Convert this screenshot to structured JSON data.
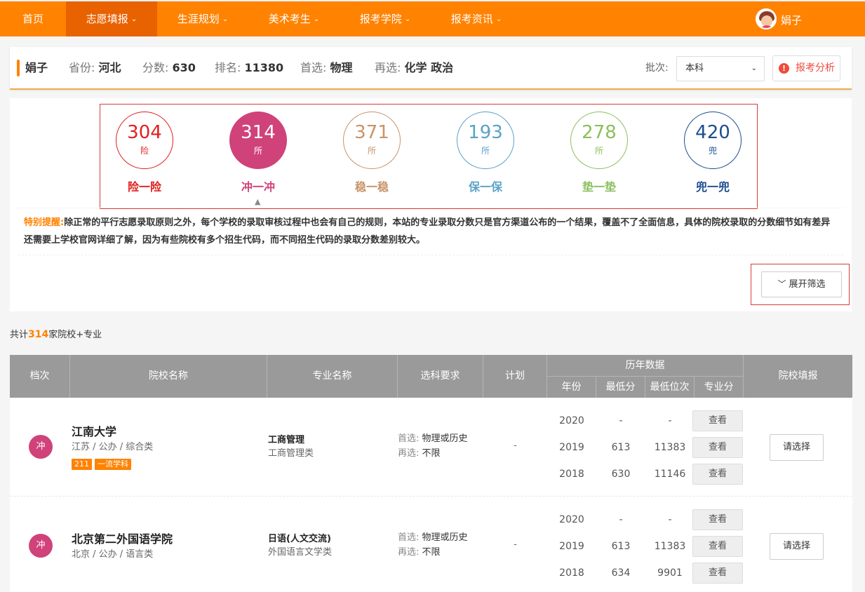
{
  "nav": {
    "items": [
      {
        "label": "首页",
        "has_menu": false
      },
      {
        "label": "志愿填报",
        "has_menu": true,
        "active": true
      },
      {
        "label": "生涯规划",
        "has_menu": true
      },
      {
        "label": "美术考生",
        "has_menu": true
      },
      {
        "label": "报考学院",
        "has_menu": true
      },
      {
        "label": "报考资讯",
        "has_menu": true
      }
    ],
    "user_name": "娟子"
  },
  "info": {
    "name": "娟子",
    "province_label": "省份:",
    "province": "河北",
    "score_label": "分数:",
    "score": "630",
    "rank_label": "排名:",
    "rank": "11380",
    "first_label": "首选:",
    "first": "物理",
    "second_label": "再选:",
    "second": "化学 政治",
    "batch_label": "批次:",
    "batch_value": "本科",
    "analysis_label": "报考分析"
  },
  "stats": [
    {
      "num": "304",
      "unit": "险",
      "label": "险一险",
      "color": "#e02020"
    },
    {
      "num": "314",
      "unit": "所",
      "label": "冲一冲",
      "color": "#d0427a",
      "active": true
    },
    {
      "num": "371",
      "unit": "所",
      "label": "稳一稳",
      "color": "#c8946a"
    },
    {
      "num": "193",
      "unit": "所",
      "label": "保一保",
      "color": "#5aa2c8"
    },
    {
      "num": "278",
      "unit": "所",
      "label": "垫一垫",
      "color": "#8bbf5e"
    },
    {
      "num": "420",
      "unit": "兜",
      "label": "兜一兜",
      "color": "#1d4e8f"
    }
  ],
  "notice": {
    "tag": "特别提醒:",
    "text": "除正常的平行志愿录取原则之外，每个学校的录取审核过程中也会有自己的规则，本站的专业录取分数只是官方渠道公布的一个结果，覆盖不了全面信息，具体的院校录取的分数细节如有差异还需要上学校官网详细了解，因为有些院校有多个招生代码，而不同招生代码的录取分数差别较大。"
  },
  "expand_label": "展开筛选",
  "count": {
    "prefix": "共计",
    "num": "314",
    "suffix": "家院校+专业"
  },
  "table": {
    "headers": {
      "level": "档次",
      "school": "院校名称",
      "major": "专业名称",
      "req": "选科要求",
      "plan": "计划",
      "history": "历年数据",
      "year": "年份",
      "min_score": "最低分",
      "min_rank": "最低位次",
      "major_score": "专业分",
      "fill": "院校填报"
    },
    "rows": [
      {
        "badge": "冲",
        "school": "江南大学",
        "meta": "江苏 / 公办 / 综合类",
        "tags": [
          "211",
          "一流学科"
        ],
        "major": "工商管理",
        "major_cat": "工商管理类",
        "req_first_label": "首选:",
        "req_first": "物理或历史",
        "req_second_label": "再选:",
        "req_second": "不限",
        "plan": "-",
        "years": [
          {
            "year": "2020",
            "min": "-",
            "rank": "-",
            "view": "查看"
          },
          {
            "year": "2019",
            "min": "613",
            "rank": "11383",
            "view": "查看"
          },
          {
            "year": "2018",
            "min": "630",
            "rank": "11146",
            "view": "查看"
          }
        ],
        "choose": "请选择"
      },
      {
        "badge": "冲",
        "school": "北京第二外国语学院",
        "meta": "北京 / 公办 / 语言类",
        "tags": [],
        "major": "日语(人文交流)",
        "major_cat": "外国语言文学类",
        "req_first_label": "首选:",
        "req_first": "物理或历史",
        "req_second_label": "再选:",
        "req_second": "不限",
        "plan": "-",
        "years": [
          {
            "year": "2020",
            "min": "-",
            "rank": "-",
            "view": "查看"
          },
          {
            "year": "2019",
            "min": "613",
            "rank": "11383",
            "view": "查看"
          },
          {
            "year": "2018",
            "min": "634",
            "rank": "9901",
            "view": "查看"
          }
        ],
        "choose": "请选择"
      }
    ]
  }
}
